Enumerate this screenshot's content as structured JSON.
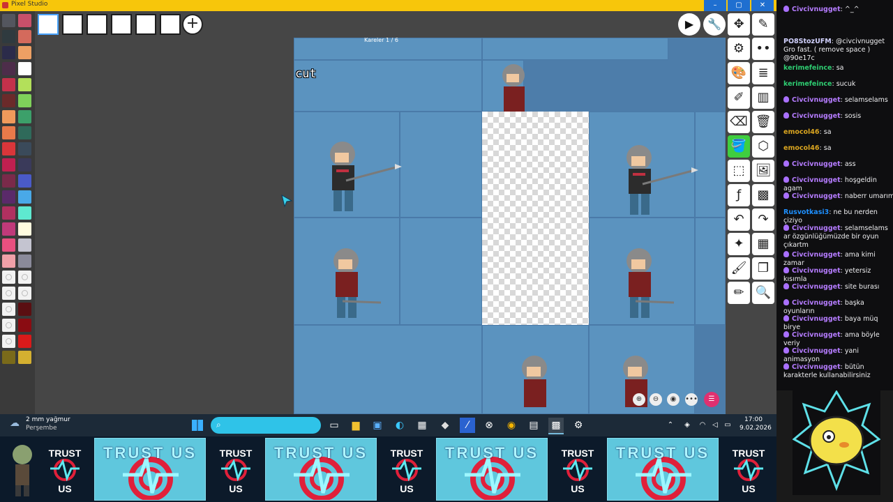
{
  "window": {
    "title": "Pixel Studio",
    "controls": [
      "–",
      "▢",
      "✕"
    ]
  },
  "frames": {
    "indicator": "Kareler 1 / 6"
  },
  "canvas": {
    "overlay_text": "cut"
  },
  "palette": {
    "colors": [
      "#54565e",
      "#c8506a",
      "#2f3a3f",
      "#d46a5c",
      "#2b2b4a",
      "#eda064",
      "#4d2d4a",
      "#ffffff",
      "#c4314b",
      "#b3e05a",
      "#6b2a2a",
      "#7fd15a",
      "#f09a5b",
      "#3ca06a",
      "#e87a4a",
      "#2f6a5a",
      "#d9363a",
      "#3a4a5a",
      "#c02050",
      "#3a3a5a",
      "#7a2a4a",
      "#4a5ac8",
      "#5a2a6a",
      "#49a9e8",
      "#b03060",
      "#5ee9d0",
      "#c03a7a",
      "#fffbe0",
      "#e85080",
      "#c4c4d0",
      "#f0a0a8",
      "#8a8a9a",
      "#empty",
      "#empty",
      "#empty",
      "#empty",
      "#empty",
      "#5a0f12",
      "#empty",
      "#8a0c12",
      "#empty",
      "#d91a1a",
      "#7a6a1a",
      "#d4b030"
    ]
  },
  "toolbar": {
    "play": "▶",
    "settings": "⚙",
    "more": "••",
    "tools": [
      "✥",
      "✎",
      "⚙",
      "•••",
      "🎨",
      "☰",
      "💉",
      "▦",
      "⌫",
      "🗑",
      "🪣",
      "⬡",
      "⬚",
      "🖼",
      "ƒ",
      "▩",
      "↶",
      "↷",
      "✦",
      "▦",
      "🖌",
      "❐",
      "✏",
      "🔍"
    ]
  },
  "canvas_controls": [
    "⊕",
    "⊖",
    "◉",
    "•••",
    "☰"
  ],
  "chat": {
    "messages": [
      {
        "user": "Civcivnugget",
        "badge": true,
        "text": "^_^",
        "color": "#b57cff"
      },
      {
        "user": "PO8StozUFM",
        "badge": false,
        "text": "@civcivnugget Gro fast. ( remove space ) @90e17c",
        "color": "#d2d2ff"
      },
      {
        "user": "kerimefeince",
        "badge": false,
        "text": "sa",
        "color": "#2ecc71"
      },
      {
        "user": "kerimefeince",
        "badge": false,
        "text": "sucuk",
        "color": "#2ecc71"
      },
      {
        "user": "Civcivnugget",
        "badge": true,
        "text": "selamselams",
        "color": "#b57cff"
      },
      {
        "user": "Civcivnugget",
        "badge": true,
        "text": "sosis",
        "color": "#b57cff"
      },
      {
        "user": "emocol46",
        "badge": false,
        "text": "sa",
        "color": "#daa520"
      },
      {
        "user": "emocol46",
        "badge": false,
        "text": "sa",
        "color": "#daa520"
      },
      {
        "user": "Civcivnugget",
        "badge": true,
        "text": "ass",
        "color": "#b57cff"
      },
      {
        "user": "Civcivnugget",
        "badge": true,
        "text": "hoşgeldin agam",
        "color": "#b57cff"
      },
      {
        "user": "Civcivnugget",
        "badge": true,
        "text": "naberr umarım",
        "color": "#b57cff"
      },
      {
        "user": "Rusvotkasi3",
        "badge": false,
        "text": "ne bu nerden çiziyo",
        "color": "#1e90ff"
      },
      {
        "user": "Civcivnugget",
        "badge": true,
        "text": "selamselams ar özgünlüğümüzde bir oyun çıkartm",
        "color": "#b57cff"
      },
      {
        "user": "Civcivnugget",
        "badge": true,
        "text": "ama kimi zamar",
        "color": "#b57cff"
      },
      {
        "user": "Civcivnugget",
        "badge": true,
        "text": "yetersiz kısımla",
        "color": "#b57cff"
      },
      {
        "user": "Civcivnugget",
        "badge": true,
        "text": "site burası",
        "color": "#b57cff"
      },
      {
        "user": "Civcivnugget",
        "badge": true,
        "text": "başka oyunların",
        "color": "#b57cff"
      },
      {
        "user": "Civcivnugget",
        "badge": true,
        "text": "baya müq birye",
        "color": "#b57cff"
      },
      {
        "user": "Civcivnugget",
        "badge": true,
        "text": "ama böyle veriy",
        "color": "#b57cff"
      },
      {
        "user": "Civcivnugget",
        "badge": true,
        "text": "yani animasyon",
        "color": "#b57cff"
      },
      {
        "user": "Civcivnugget",
        "badge": true,
        "text": "bütün karakterle kullanabilirsiniz",
        "color": "#b57cff"
      }
    ]
  },
  "taskbar": {
    "weather_temp": "2 mm yağmur",
    "weather_day": "Perşembe",
    "time": "17:00",
    "date": "9.02.2026"
  },
  "banner": {
    "small_text_top": "TRUST",
    "small_text_bottom": "US",
    "big_text": "TRUST US"
  }
}
